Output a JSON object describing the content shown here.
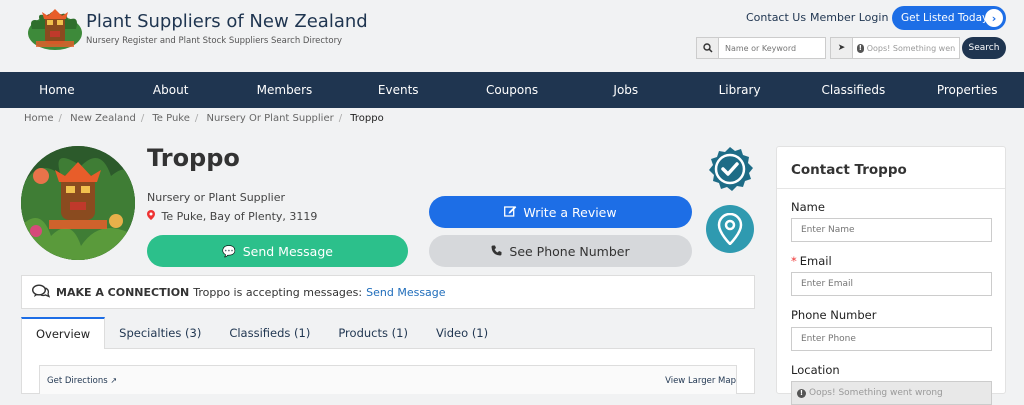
{
  "header": {
    "site_title": "Plant Suppliers of New Zealand",
    "tagline": "Nursery Register and Plant Stock Suppliers Search Directory",
    "contact_us": "Contact Us",
    "member_login": "Member Login",
    "get_listed": "Get Listed Today",
    "search_placeholder": "Name or Keyword",
    "location_error": "Oops! Something went wrong",
    "search_button": "Search"
  },
  "nav": [
    "Home",
    "About",
    "Members",
    "Events",
    "Coupons",
    "Jobs",
    "Library",
    "Classifieds",
    "Properties"
  ],
  "breadcrumbs": [
    "Home",
    "New Zealand",
    "Te Puke",
    "Nursery Or Plant Supplier"
  ],
  "breadcrumb_current": "Troppo",
  "profile": {
    "name": "Troppo",
    "category": "Nursery or Plant Supplier",
    "location": "Te Puke, Bay of Plenty, 3119",
    "send_message": "Send Message",
    "write_review": "Write a Review",
    "see_phone": "See Phone Number"
  },
  "connection": {
    "heading": "MAKE A CONNECTION",
    "text": "Troppo is accepting messages:",
    "link": "Send Message"
  },
  "tabs": [
    "Overview",
    "Specialties (3)",
    "Classifieds (1)",
    "Products (1)",
    "Video (1)"
  ],
  "map": {
    "directions": "Get Directions",
    "larger": "View Larger Map"
  },
  "contact_form": {
    "title": "Contact Troppo",
    "name_label": "Name",
    "name_placeholder": "Enter Name",
    "email_label": "Email",
    "email_required": "*",
    "email_placeholder": "Enter Email",
    "phone_label": "Phone Number",
    "phone_placeholder": "Enter Phone",
    "location_label": "Location",
    "location_error": "Oops! Something went wrong"
  },
  "colors": {
    "navy": "#1f3550",
    "blue": "#1d6ee6",
    "green": "#2cc08b",
    "teal": "#2f9ab0"
  }
}
